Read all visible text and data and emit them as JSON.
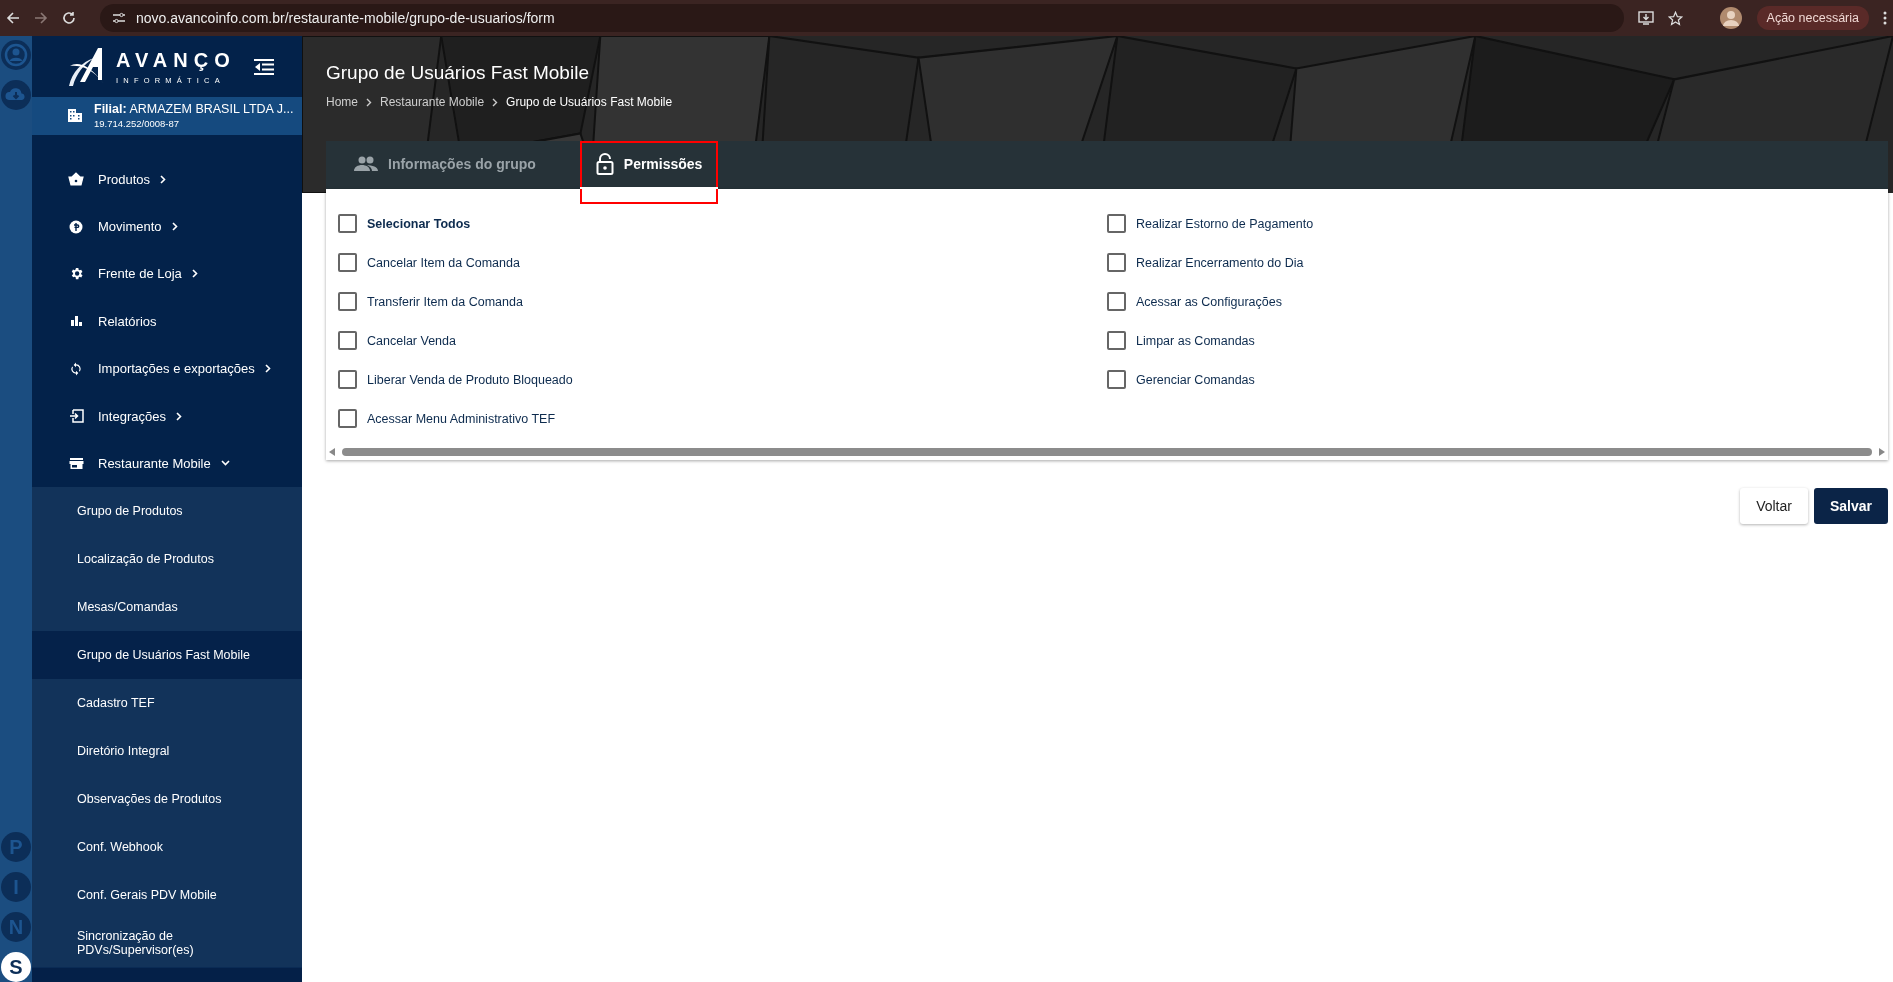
{
  "browser": {
    "url": "novo.avancoinfo.com.br/restaurante-mobile/grupo-de-usuarios/form",
    "action_label": "Ação necessária"
  },
  "rail": {
    "letters": [
      {
        "letter": "P",
        "selected": false
      },
      {
        "letter": "I",
        "selected": false
      },
      {
        "letter": "N",
        "selected": false
      },
      {
        "letter": "S",
        "selected": true
      }
    ]
  },
  "sidebar": {
    "brand": {
      "name": "AVANÇO",
      "tagline": "INFORMÁTICA"
    },
    "branch": {
      "label": "Filial:",
      "name": "ARMAZEM BRASIL LTDA J...",
      "cnpj": "19.714.252/0008-87"
    },
    "menu": [
      {
        "label": "Produtos",
        "kind": "group",
        "expanded": false
      },
      {
        "label": "Movimento",
        "kind": "group",
        "expanded": false
      },
      {
        "label": "Frente de Loja",
        "kind": "group",
        "expanded": false
      },
      {
        "label": "Relatórios",
        "kind": "link"
      },
      {
        "label": "Importações e exportações",
        "kind": "group",
        "expanded": false
      },
      {
        "label": "Integrações",
        "kind": "group",
        "expanded": false
      },
      {
        "label": "Restaurante Mobile",
        "kind": "group",
        "expanded": true,
        "children": [
          {
            "label": "Grupo de Produtos",
            "selected": false
          },
          {
            "label": "Localização de Produtos",
            "selected": false
          },
          {
            "label": "Mesas/Comandas",
            "selected": false
          },
          {
            "label": "Grupo de Usuários Fast Mobile",
            "selected": true
          },
          {
            "label": "Cadastro TEF",
            "selected": false
          },
          {
            "label": "Diretório Integral",
            "selected": false
          },
          {
            "label": "Observações de Produtos",
            "selected": false
          },
          {
            "label": "Conf. Webhook",
            "selected": false
          },
          {
            "label": "Conf. Gerais PDV Mobile",
            "selected": false
          },
          {
            "label": "Sincronização de PDVs/Supervisor(es)",
            "selected": false
          }
        ]
      }
    ]
  },
  "header": {
    "title": "Grupo de Usuários Fast Mobile",
    "breadcrumbs": [
      "Home",
      "Restaurante Mobile",
      "Grupo de Usuários Fast Mobile"
    ]
  },
  "tabs": [
    {
      "label": "Informações do grupo",
      "selected": false,
      "highlighted": false
    },
    {
      "label": "Permissões",
      "selected": true,
      "highlighted": true
    }
  ],
  "permissions": {
    "columns": [
      [
        {
          "label": "Selecionar Todos",
          "kind": "select_all",
          "checked": false
        },
        {
          "label": "Cancelar Item da Comanda",
          "kind": "permission",
          "checked": false
        },
        {
          "label": "Transferir Item da Comanda",
          "kind": "permission",
          "checked": false
        },
        {
          "label": "Cancelar Venda",
          "kind": "permission",
          "checked": false
        },
        {
          "label": "Liberar Venda de Produto Bloqueado",
          "kind": "permission",
          "checked": false
        },
        {
          "label": "Acessar Menu Administrativo TEF",
          "kind": "permission",
          "checked": false
        }
      ],
      [
        {
          "label": "Realizar Estorno de Pagamento",
          "kind": "permission",
          "checked": false
        },
        {
          "label": "Realizar Encerramento do Dia",
          "kind": "permission",
          "checked": false
        },
        {
          "label": "Acessar as Configurações",
          "kind": "permission",
          "checked": false
        },
        {
          "label": "Limpar as Comandas",
          "kind": "permission",
          "checked": false
        },
        {
          "label": "Gerenciar Comandas",
          "kind": "permission",
          "checked": false
        }
      ]
    ]
  },
  "buttons": [
    {
      "label": "Voltar",
      "kind": "secondary"
    },
    {
      "label": "Salvar",
      "kind": "primary"
    }
  ]
}
